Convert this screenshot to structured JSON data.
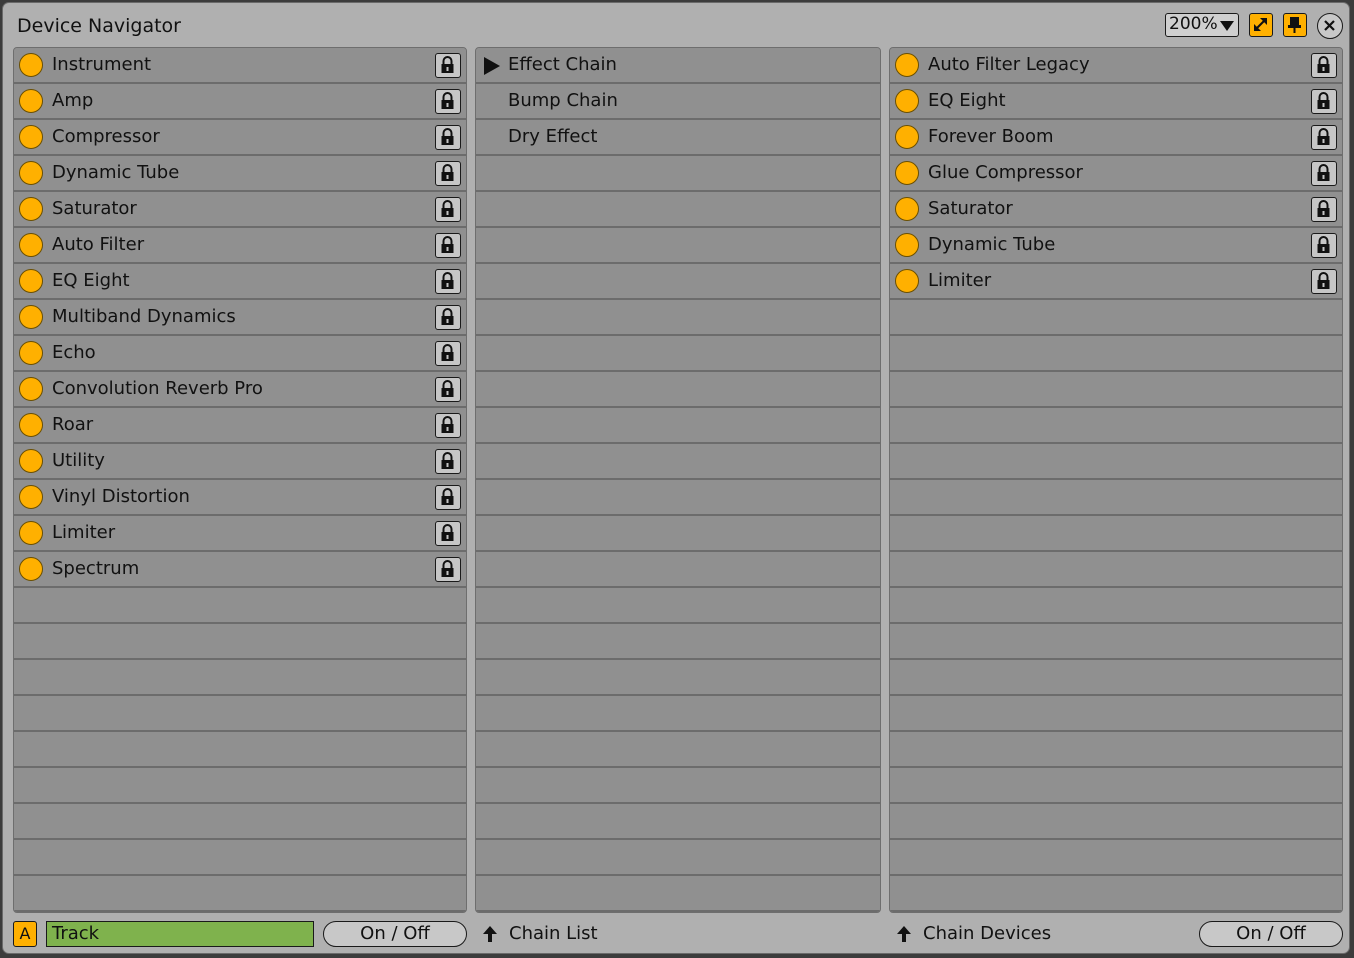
{
  "window": {
    "title": "Device Navigator"
  },
  "toolbar": {
    "zoom_value": "200%"
  },
  "colors": {
    "accent": "#ffb000",
    "track_field": "#7fb24d",
    "panel_bg": "#909090",
    "window_bg": "#b0b0b0"
  },
  "devices": {
    "items": [
      {
        "label": "Instrument",
        "icon": "lock-icon"
      },
      {
        "label": "Amp",
        "icon": "lock-icon"
      },
      {
        "label": "Compressor",
        "icon": "lock-icon"
      },
      {
        "label": "Dynamic Tube",
        "icon": "lock-icon"
      },
      {
        "label": "Saturator",
        "icon": "lock-icon"
      },
      {
        "label": "Auto Filter",
        "icon": "lock-icon"
      },
      {
        "label": "EQ Eight",
        "icon": "lock-icon"
      },
      {
        "label": "Multiband Dynamics",
        "icon": "lock-icon"
      },
      {
        "label": "Echo",
        "icon": "lock-icon"
      },
      {
        "label": "Convolution Reverb Pro",
        "icon": "lock-icon"
      },
      {
        "label": "Roar",
        "icon": "lock-icon"
      },
      {
        "label": "Utility",
        "icon": "lock-icon"
      },
      {
        "label": "Vinyl Distortion",
        "icon": "lock-icon"
      },
      {
        "label": "Limiter",
        "icon": "lock-icon"
      },
      {
        "label": "Spectrum",
        "icon": "lock-icon"
      }
    ]
  },
  "chains": {
    "items": [
      {
        "label": "Effect Chain",
        "selected": true
      },
      {
        "label": "Bump Chain",
        "selected": false
      },
      {
        "label": "Dry Effect",
        "selected": false
      }
    ]
  },
  "chain_devices": {
    "items": [
      {
        "label": "Auto Filter Legacy"
      },
      {
        "label": "EQ Eight"
      },
      {
        "label": "Forever Boom"
      },
      {
        "label": "Glue Compressor"
      },
      {
        "label": "Saturator"
      },
      {
        "label": "Dynamic Tube"
      },
      {
        "label": "Limiter"
      }
    ]
  },
  "footer": {
    "a_label": "A",
    "track_label": "Track",
    "on_off_label": "On / Off",
    "chain_list_label": "Chain List",
    "chain_devices_label": "Chain Devices",
    "chain_on_off_label": "On / Off"
  }
}
